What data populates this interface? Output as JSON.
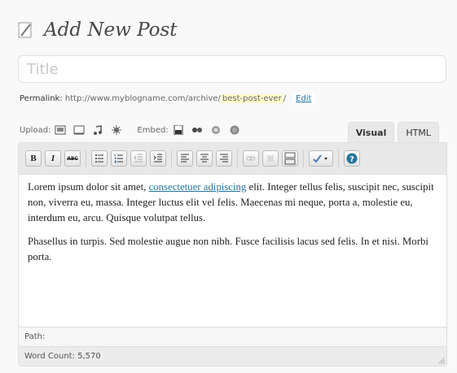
{
  "page": {
    "title": "Add New Post"
  },
  "title_field": {
    "placeholder": "Title",
    "value": ""
  },
  "permalink": {
    "label": "Permalink:",
    "base_url": "http://www.myblogname.com/archive/",
    "slug": "best-post-ever",
    "trailing": "/",
    "edit_label": "Edit"
  },
  "media": {
    "upload_label": "Upload:",
    "embed_label": "Embed:",
    "upload_icons": [
      "image-icon",
      "video-icon",
      "audio-icon",
      "media-icon"
    ],
    "embed_icons": [
      "youtube-icon",
      "flickr-icon",
      "vimeo-icon",
      "globe-icon"
    ]
  },
  "editor_tabs": {
    "visual": "Visual",
    "html": "HTML",
    "active": "Visual"
  },
  "toolbar": {
    "bold": "B",
    "italic": "I",
    "strikethrough": "ABC",
    "buttons": [
      "bold",
      "italic",
      "strikethrough",
      "bullet-list",
      "numbered-list",
      "outdent",
      "indent",
      "align-left",
      "align-center",
      "align-right",
      "link",
      "unlink",
      "more-tag",
      "spellcheck",
      "help"
    ]
  },
  "content": {
    "p1_before": "Lorem ipsum dolor sit amet, ",
    "p1_link": "consectetuer adipiscing",
    "p1_after": " elit. Integer tellus felis, suscipit nec, suscipit non, viverra eu, massa. Integer luctus elit vel felis. Maecenas mi neque, porta a, molestie eu, interdum eu, arcu. Quisque volutpat tellus.",
    "p2": "Phasellus in turpis. Sed molestie augue non nibh. Fusce facilisis lacus sed felis. In et nisi. Morbi porta."
  },
  "status": {
    "path_label": "Path:",
    "word_count_label": "Word Count:",
    "word_count": "5,570"
  },
  "colors": {
    "link": "#21759b",
    "slug_highlight": "#fffbcc",
    "toolbar_bg": "#e8e8e8",
    "help": "#21759b"
  }
}
